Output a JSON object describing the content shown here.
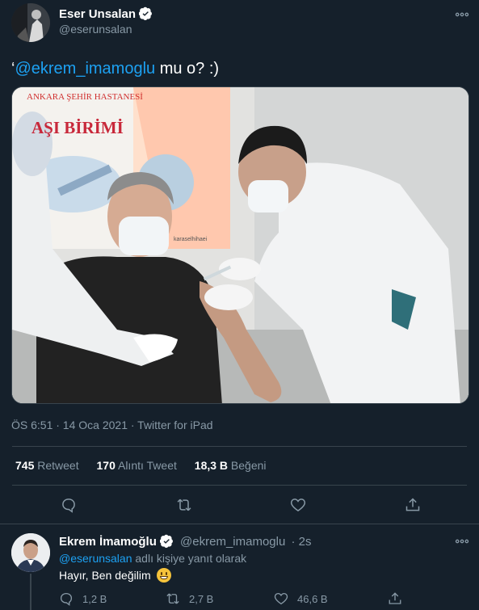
{
  "main_tweet": {
    "author_name": "Eser Unsalan",
    "handle": "@eserunsalan",
    "text_prefix": "‘",
    "text_mention": "@ekrem_imamoglu",
    "text_rest": " mu o? :)",
    "photo_sign_line1": "ANKARA ŞEHİR HASTANESİ",
    "photo_sign_line2": "AŞI BİRİMİ",
    "photo_sign_small": "karaselhihaei",
    "timestamp": "ÖS 6:51 · 14 Oca 2021 · Twitter for iPad",
    "stats": {
      "retweets_count": "745",
      "retweets_label": "Retweet",
      "quotes_count": "170",
      "quotes_label": "Alıntı Tweet",
      "likes_count": "18,3 B",
      "likes_label": "Beğeni"
    }
  },
  "reply": {
    "author_name": "Ekrem İmamoğlu",
    "handle": "@ekrem_imamoglu",
    "time": "· 2s",
    "replying_mention": "@eserunsalan",
    "replying_suffix": " adlı kişiye yanıt olarak",
    "text": "Hayır, Ben değilim",
    "emoji": "😀",
    "reply_count": "1,2 B",
    "retweet_count": "2,7 B",
    "like_count": "46,6 B"
  },
  "colors": {
    "background": "#15202b",
    "link": "#1da1f2",
    "muted": "#8899a6",
    "divider": "#38444d",
    "verified": "#ffffff"
  }
}
